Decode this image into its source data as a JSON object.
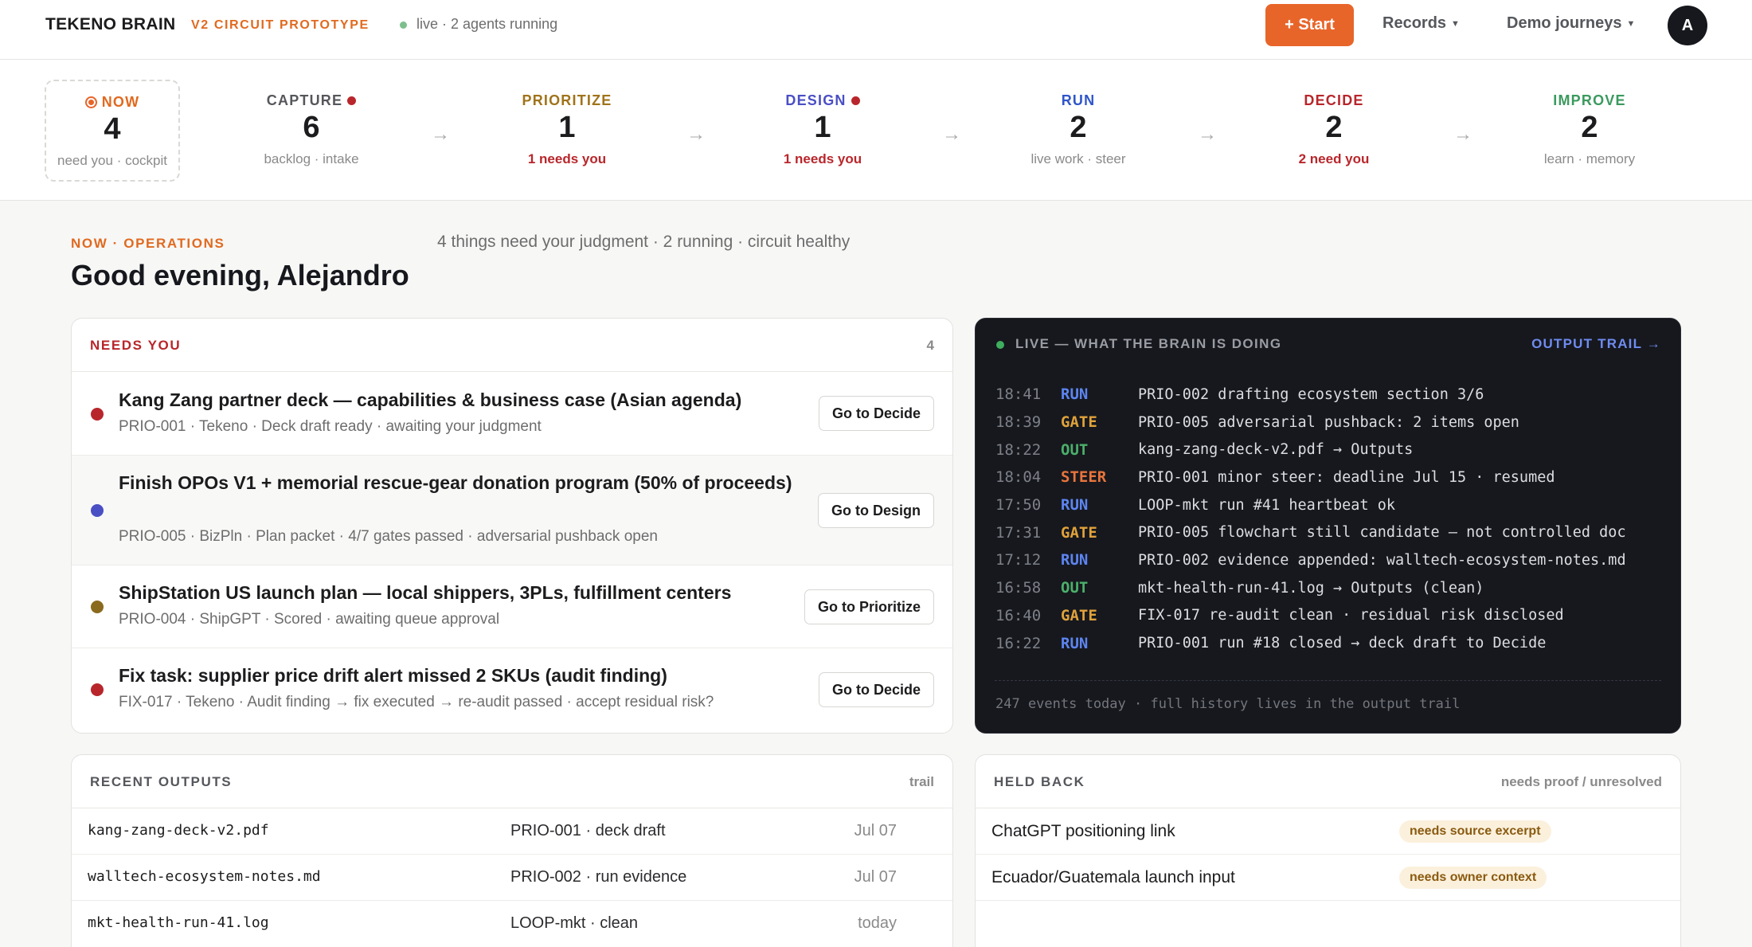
{
  "header": {
    "brand": "TEKENO BRAIN",
    "prototype": "V2 CIRCUIT PROTOTYPE",
    "status": "live · 2 agents running",
    "start_label": "+ Start",
    "records_label": "Records",
    "demo_label": "Demo journeys",
    "avatar_initial": "A",
    "accent_color": "#e8652a"
  },
  "pipeline": {
    "stages": [
      {
        "label": "NOW",
        "count": "4",
        "sub": "need you · cockpit",
        "color": "#e06a1f"
      },
      {
        "label": "CAPTURE",
        "count": "6",
        "sub": "backlog · intake",
        "color": "#55575c"
      },
      {
        "label": "PRIORITIZE",
        "count": "1",
        "sub": "1 needs you",
        "color": "#a0731a"
      },
      {
        "label": "DESIGN",
        "count": "1",
        "sub": "1 needs you",
        "color": "#4a4fc4"
      },
      {
        "label": "RUN",
        "count": "2",
        "sub": "live work · steer",
        "color": "#2f55c9"
      },
      {
        "label": "DECIDE",
        "count": "2",
        "sub": "2 need you",
        "color": "#b8262b"
      },
      {
        "label": "IMPROVE",
        "count": "2",
        "sub": "learn · memory",
        "color": "#3b9a5e"
      }
    ]
  },
  "page": {
    "kicker": "NOW · OPERATIONS",
    "summary": "4 things need your judgment · 2 running · circuit healthy",
    "greeting": "Good evening, Alejandro"
  },
  "needs_you": {
    "title": "NEEDS YOU",
    "count": "4",
    "items": [
      {
        "title": "Kang Zang partner deck — capabilities & business case (Asian agenda)",
        "sub": "PRIO-001 · Tekeno · Deck draft ready · awaiting your judgment",
        "action": "Go to Decide",
        "dot_color": "#b8262b"
      },
      {
        "title": "Finish OPOs V1 + memorial rescue-gear donation program (50% of proceeds)",
        "sub": "PRIO-005 · BizPln · Plan packet · 4/7 gates passed · adversarial pushback open",
        "action": "Go to Design",
        "dot_color": "#4a4fc4"
      },
      {
        "title": "ShipStation US launch plan — local shippers, 3PLs, fulfillment centers",
        "sub": "PRIO-004 · ShipGPT · Scored · awaiting queue approval",
        "action": "Go to Prioritize",
        "dot_color": "#8a6a1e"
      },
      {
        "title": "Fix task: supplier price drift alert missed 2 SKUs (audit finding)",
        "sub": "FIX-017 · Tekeno · Audit finding → fix executed → re-audit passed · accept residual risk?",
        "action": "Go to Decide",
        "dot_color": "#b8262b"
      }
    ]
  },
  "live": {
    "title": "LIVE — WHAT THE BRAIN IS DOING",
    "link": "OUTPUT TRAIL →",
    "events": [
      {
        "time": "18:41",
        "kind": "RUN",
        "msg": "PRIO-002 drafting ecosystem section 3/6"
      },
      {
        "time": "18:39",
        "kind": "GATE",
        "msg": "PRIO-005 adversarial pushback: 2 items open"
      },
      {
        "time": "18:22",
        "kind": "OUT",
        "msg": "kang-zang-deck-v2.pdf → Outputs"
      },
      {
        "time": "18:04",
        "kind": "STEER",
        "msg": "PRIO-001 minor steer: deadline Jul 15 · resumed"
      },
      {
        "time": "17:50",
        "kind": "RUN",
        "msg": "LOOP-mkt run #41 heartbeat ok"
      },
      {
        "time": "17:31",
        "kind": "GATE",
        "msg": "PRIO-005 flowchart still candidate — not controlled doc"
      },
      {
        "time": "17:12",
        "kind": "RUN",
        "msg": "PRIO-002 evidence appended: walltech-ecosystem-notes.md"
      },
      {
        "time": "16:58",
        "kind": "OUT",
        "msg": "mkt-health-run-41.log → Outputs (clean)"
      },
      {
        "time": "16:40",
        "kind": "GATE",
        "msg": "FIX-017 re-audit clean · residual risk disclosed"
      },
      {
        "time": "16:22",
        "kind": "RUN",
        "msg": "PRIO-001 run #18 closed → deck draft to Decide"
      }
    ],
    "footer": "247 events today · full history lives in the output trail"
  },
  "outputs": {
    "title": "RECENT OUTPUTS",
    "meta": "trail",
    "rows": [
      {
        "file": "kang-zang-deck-v2.pdf",
        "ref": "PRIO-001 · deck draft",
        "date": "Jul 07"
      },
      {
        "file": "walltech-ecosystem-notes.md",
        "ref": "PRIO-002 · run evidence",
        "date": "Jul 07"
      },
      {
        "file": "mkt-health-run-41.log",
        "ref": "LOOP-mkt · clean",
        "date": "today"
      }
    ]
  },
  "held": {
    "title": "HELD BACK",
    "meta": "needs proof / unresolved",
    "rows": [
      {
        "label": "ChatGPT positioning link",
        "tag": "needs source excerpt"
      },
      {
        "label": "Ecuador/Guatemala launch input",
        "tag": "needs owner context"
      }
    ]
  }
}
